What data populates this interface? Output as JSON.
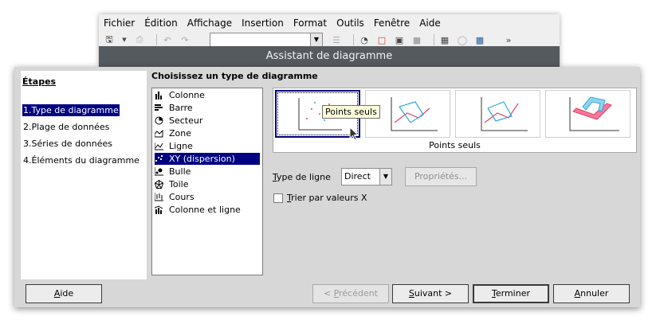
{
  "app": {
    "menu": [
      "Fichier",
      "Édition",
      "Affichage",
      "Insertion",
      "Format",
      "Outils",
      "Fenêtre",
      "Aide"
    ],
    "style_combo_value": ""
  },
  "dialog": {
    "title": "Assistant de diagramme",
    "steps_title": "Étapes",
    "steps": [
      "1.Type de diagramme",
      "2.Plage de données",
      "3.Séries de données",
      "4.Éléments du diagramme"
    ],
    "selected_step": 0,
    "heading": "Choisissez un type de diagramme",
    "chart_types": [
      {
        "label": "Colonne",
        "icon": "column-chart-icon"
      },
      {
        "label": "Barre",
        "icon": "bar-chart-icon"
      },
      {
        "label": "Secteur",
        "icon": "pie-chart-icon"
      },
      {
        "label": "Zone",
        "icon": "area-chart-icon"
      },
      {
        "label": "Ligne",
        "icon": "line-chart-icon"
      },
      {
        "label": "XY (dispersion)",
        "icon": "scatter-chart-icon"
      },
      {
        "label": "Bulle",
        "icon": "bubble-chart-icon"
      },
      {
        "label": "Toile",
        "icon": "net-chart-icon"
      },
      {
        "label": "Cours",
        "icon": "stock-chart-icon"
      },
      {
        "label": "Colonne et ligne",
        "icon": "column-line-chart-icon"
      }
    ],
    "selected_type": 5,
    "variant_caption": "Points seuls",
    "tooltip": "Points seuls",
    "line_type_label": "Type de ligne",
    "line_type_value": "Direct",
    "properties_button": "Propriétés...",
    "sort_label": "Trier par valeurs X",
    "sort_checked": false,
    "buttons": {
      "help": "Aide",
      "back": "< Précédent",
      "next": "Suivant >",
      "finish": "Terminer",
      "cancel": "Annuler"
    },
    "colors": {
      "selection": "#000080",
      "series_red": "#e8426a",
      "series_blue": "#33a7d6",
      "dialog_bg": "#d7d7d7",
      "titlebar": "#555a5f"
    }
  }
}
